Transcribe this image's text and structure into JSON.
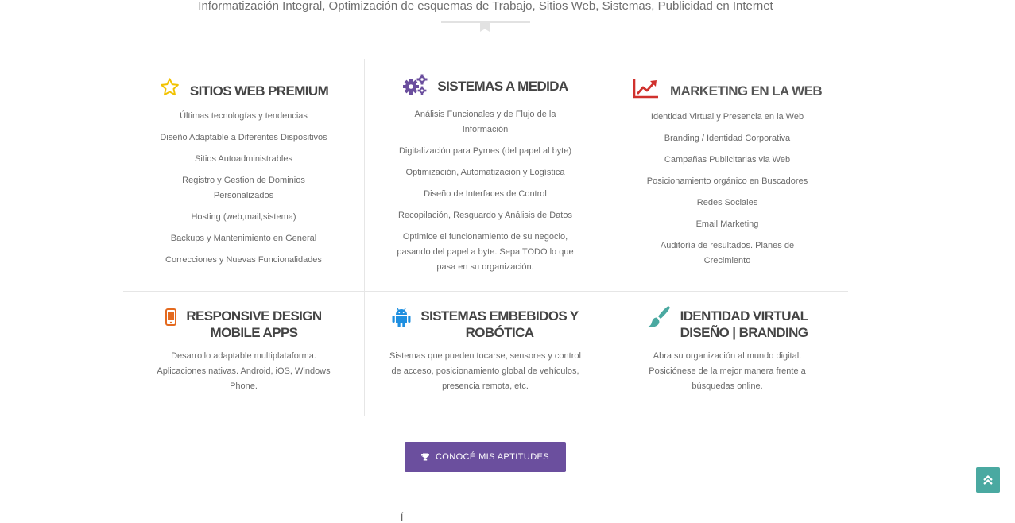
{
  "header": {
    "subtitle": "Informatización Integral, Optimización de esquemas de Trabajo, Sitios Web, Sistemas, Publicidad en Internet"
  },
  "services": [
    {
      "title": "SITIOS WEB PREMIUM",
      "icon": "star-icon",
      "icon_color": "#f2c200",
      "items": [
        "Últimas tecnologías y tendencias",
        "Diseño Adaptable a Diferentes Dispositivos",
        "Sitios Autoadministrables",
        "Registro y Gestion de Dominios Personalizados",
        "Hosting (web,mail,sistema)",
        "Backups y Mantenimiento en General",
        "Correcciones y Nuevas Funcionalidades"
      ]
    },
    {
      "title": "SISTEMAS A MEDIDA",
      "icon": "cogs-icon",
      "icon_color": "#6b4f9e",
      "items": [
        "Análisis Funcionales y de Flujo de la Información",
        "Digitalización para Pymes (del papel al byte)",
        "Optimización, Automatización y Logística",
        "Diseño de Interfaces de Control",
        "Recopilación, Resguardo y Análisis de Datos",
        "Optimice el funcionamiento de su negocio, pasando del papel a byte. Sepa TODO lo que pasa en su organización."
      ]
    },
    {
      "title": "MARKETING EN LA WEB",
      "icon": "line-chart-icon",
      "icon_color": "#d0312d",
      "items": [
        "Identidad Virtual y Presencia en la Web",
        "Branding / Identidad Corporativa",
        "Campañas Publicitarias via Web",
        "Posicionamiento orgánico en Buscadores",
        "Redes Sociales",
        "Email Marketing",
        "Auditoría de resultados. Planes de Crecimiento"
      ]
    },
    {
      "title_line1": "RESPONSIVE DESIGN",
      "title_line2": "MOBILE APPS",
      "icon": "mobile-phone-icon",
      "icon_color": "#e46a1f",
      "description": "Desarrollo adaptable multiplataforma. Aplicaciones nativas. Android, iOS, Windows Phone."
    },
    {
      "title_line1": "SISTEMAS EMBEBIDOS Y",
      "title_line2": "ROBÓTICA",
      "icon": "android-icon",
      "icon_color": "#1e8fe0",
      "description": "Sistemas que pueden tocarse, sensores y control de acceso, posicionamiento global de vehículos, presencia remota, etc."
    },
    {
      "title_line1": "IDENTIDAD VIRTUAL",
      "title_line2": "DISEÑO | BRANDING",
      "icon": "paint-brush-icon",
      "icon_color": "#4aa9a1",
      "description": "Abra su organización al mundo digital. Posiciónese de la mejor manera frente a búsquedas online."
    }
  ],
  "cta": {
    "label": "CONOCÉ MIS APTITUDES",
    "icon": "trophy-icon"
  },
  "scroll_top": {
    "icon": "double-chevron-up-icon"
  },
  "bottom_glyph": "Í"
}
